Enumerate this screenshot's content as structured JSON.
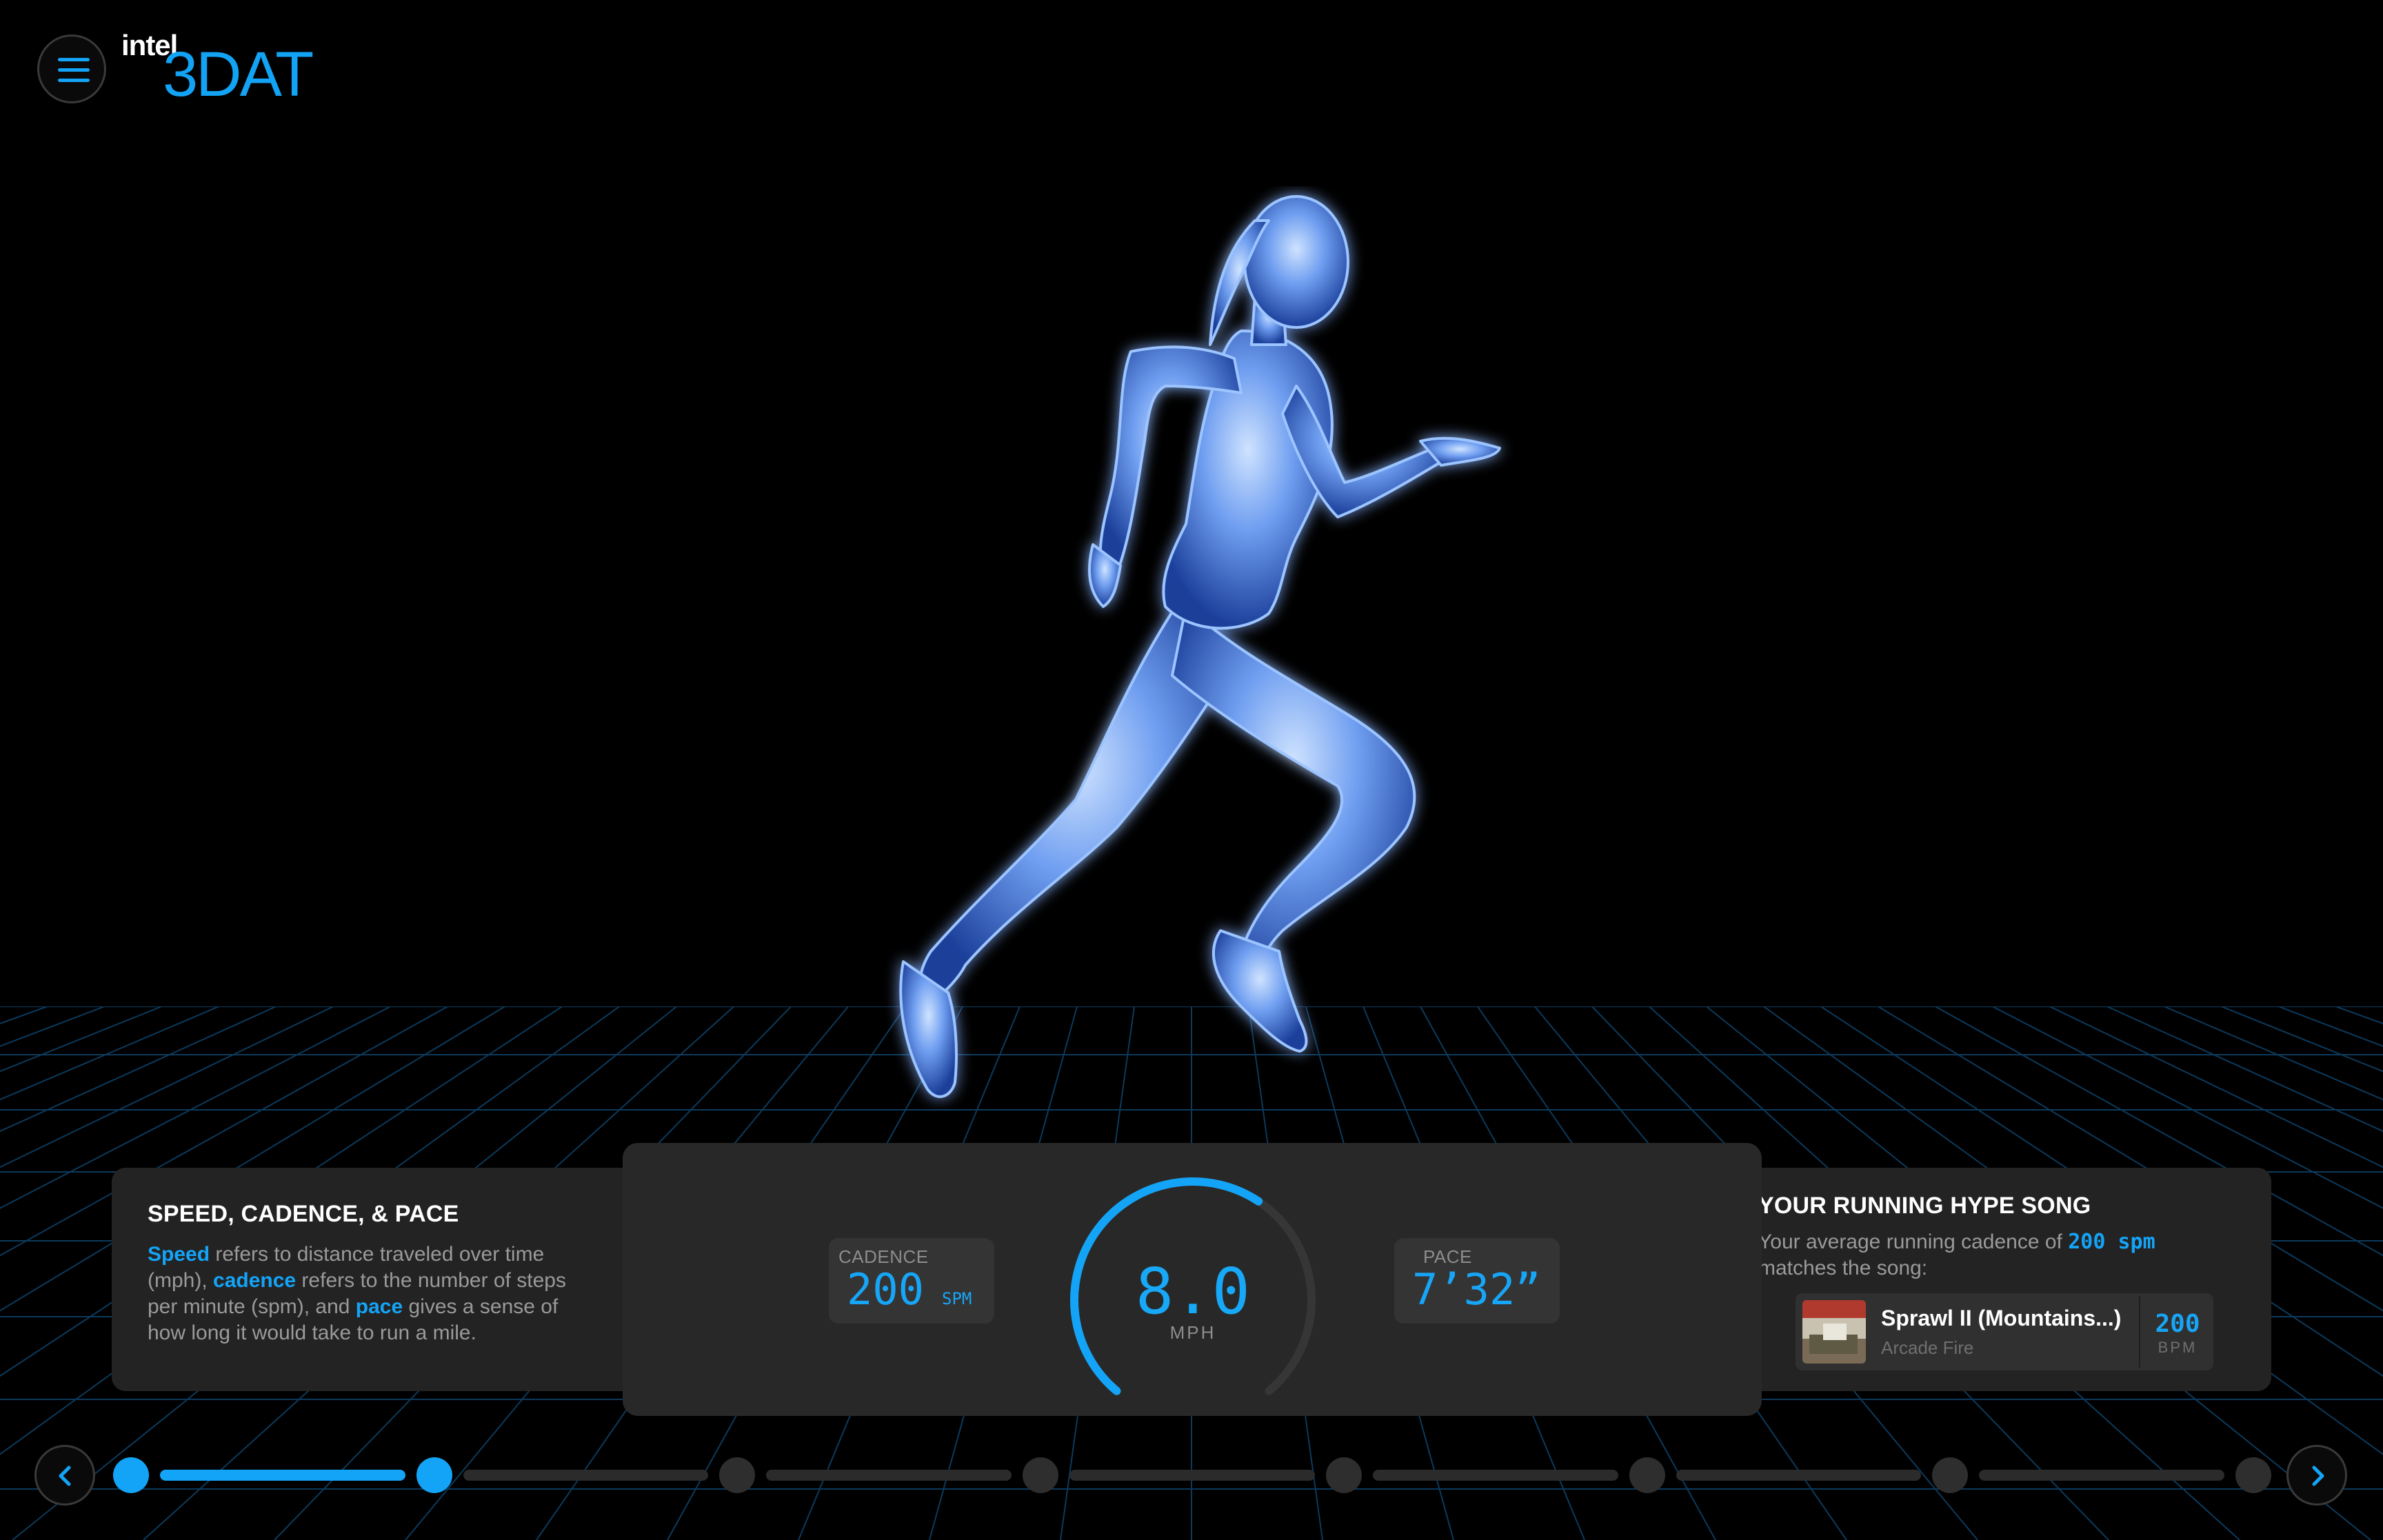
{
  "brand": {
    "small": "intel",
    "big": "3DAT"
  },
  "colors": {
    "accent": "#14a4f7",
    "panel": "#232323",
    "background": "#000000"
  },
  "menu": {
    "icon": "hamburger-menu-icon"
  },
  "info_panel": {
    "title": "SPEED, CADENCE, & PACE",
    "t1": "Speed",
    "t2": " refers to distance traveled over time (mph), ",
    "t3": "cadence",
    "t4": " refers to the number of steps per minute (spm), and ",
    "t5": "pace",
    "t6": " gives a sense of how long it would take to run a mile."
  },
  "metrics": {
    "cadence": {
      "label": "CADENCE",
      "value": "200",
      "unit": "SPM"
    },
    "speed": {
      "value": "8.0",
      "unit": "MPH",
      "gauge_fraction": 0.62
    },
    "pace": {
      "label": "PACE",
      "value": "7’32”"
    }
  },
  "song_panel": {
    "title": "YOUR RUNNING HYPE SONG",
    "d1": "Your average running cadence of ",
    "d2": "200 spm",
    "d3": " matches the song:",
    "song": {
      "title": "Sprawl II (Mountains...)",
      "artist": "Arcade Fire",
      "bpm": "200",
      "bpm_unit": "BPM"
    }
  },
  "progress": {
    "total_steps": 8,
    "current_step": 2
  },
  "icons": {
    "prev": "chevron-left-icon",
    "next": "chevron-right-icon"
  }
}
